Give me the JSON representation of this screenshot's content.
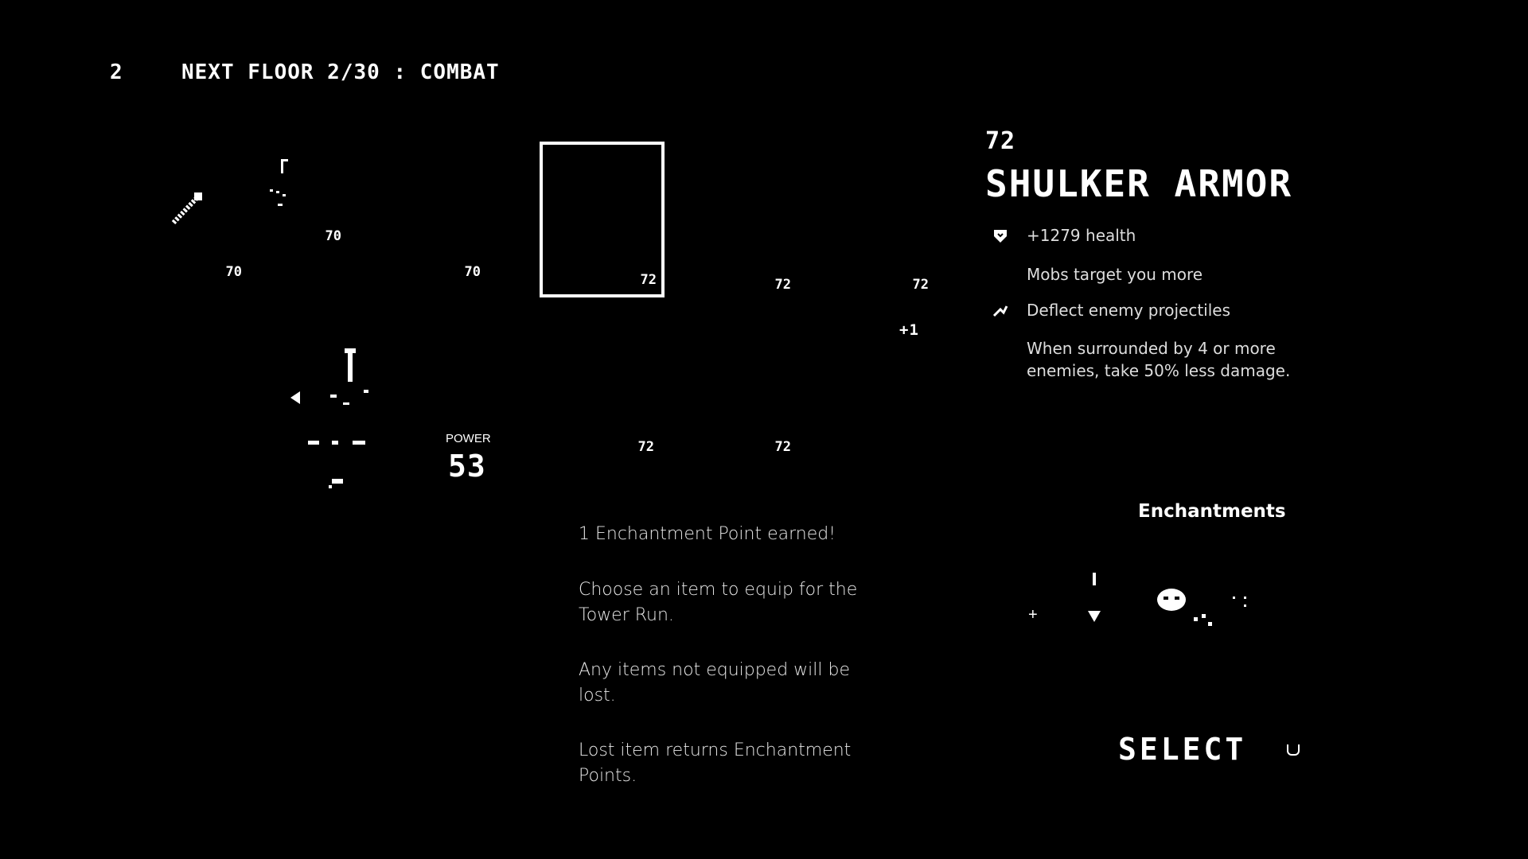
{
  "header": {
    "floor_number": "2",
    "title": "NEXT FLOOR 2/30 : COMBAT"
  },
  "slots": [
    {
      "level": "70",
      "icon": "sword-icon"
    },
    {
      "level": "70",
      "icon": "crossbow-icon"
    },
    {
      "level": "70",
      "icon": "empty"
    },
    {
      "level": "72",
      "icon": "shulker-armor-icon",
      "selected": true
    },
    {
      "level": "72",
      "icon": "empty"
    },
    {
      "level": "72",
      "icon": "empty"
    },
    {
      "level": "72",
      "icon": "empty"
    },
    {
      "level": "72",
      "icon": "empty"
    }
  ],
  "bonus": "+1",
  "power": {
    "label": "POWER",
    "value": "53"
  },
  "info": {
    "line1": "1 Enchantment Point earned!",
    "line2": "Choose an item to equip for the Tower Run.",
    "line3": "Any items not equipped will be lost.",
    "line4": "Lost item returns Enchantment Points."
  },
  "item": {
    "power": "72",
    "name": "SHULKER ARMOR",
    "stats": [
      {
        "icon": "shield-heart-icon",
        "text": "+1279 health"
      },
      {
        "icon": "",
        "text": "Mobs target you more"
      },
      {
        "icon": "deflect-icon",
        "text": "Deflect enemy projectiles"
      },
      {
        "icon": "",
        "text": "When surrounded by 4 or more enemies, take 50% less damage."
      }
    ],
    "enchantments_title": "Enchantments"
  },
  "select_label": "SELECT",
  "colors": {
    "background": "#000000",
    "foreground": "#ffffff"
  }
}
